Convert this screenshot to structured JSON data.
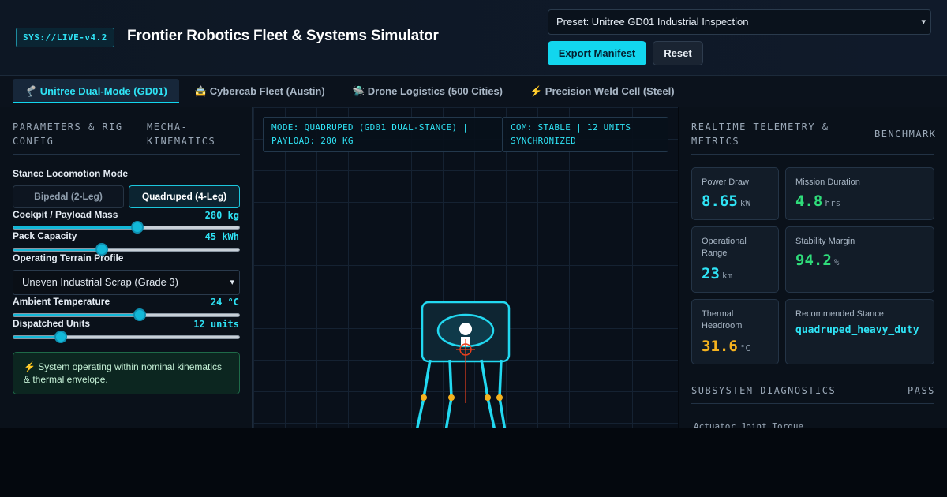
{
  "header": {
    "badge": "SYS://LIVE-v4.2",
    "title": "Frontier Robotics Fleet & Systems Simulator",
    "preset_value": "Preset: Unitree GD01 Industrial Inspection",
    "export_label": "Export Manifest",
    "reset_label": "Reset"
  },
  "tabs": [
    {
      "label": "🦿 Unitree Dual-Mode (GD01)",
      "active": true
    },
    {
      "label": "🚖 Cybercab Fleet (Austin)",
      "active": false
    },
    {
      "label": "🛸 Drone Logistics (500 Cities)",
      "active": false
    },
    {
      "label": "⚡ Precision Weld Cell (Steel)",
      "active": false
    }
  ],
  "left": {
    "head_left": "PARAMETERS & RIG CONFIG",
    "head_right": "MECHA-KINEMATICS",
    "stance_label": "Stance Locomotion Mode",
    "stance_options": [
      "Bipedal (2-Leg)",
      "Quadruped (4-Leg)"
    ],
    "payload_label": "Cockpit / Payload Mass",
    "payload_value": "280 kg",
    "payload_level": 0.55,
    "pack_label": "Pack Capacity",
    "pack_value": "45 kWh",
    "pack_level": 0.39,
    "terrain_label": "Operating Terrain Profile",
    "terrain_value": "Uneven Industrial Scrap (Grade 3)",
    "temp_label": "Ambient Temperature",
    "temp_value": "24 °C",
    "temp_level": 0.56,
    "units_label": "Dispatched Units",
    "units_value": "12 units",
    "units_level": 0.21,
    "status_text": "⚡ System operating within nominal kinematics & thermal envelope."
  },
  "center": {
    "hud_mode": "MODE: QUADRUPED (GD01 DUAL-STANCE) | PAYLOAD: 280 KG",
    "hud_com": "COM: STABLE | 12 UNITS SYNCHRONIZED"
  },
  "right": {
    "head_left": "REALTIME TELEMETRY & METRICS",
    "head_right": "BENCHMARK",
    "metrics": [
      {
        "label": "Power Draw",
        "value": "8.65",
        "unit": "kW"
      },
      {
        "label": "Mission Duration",
        "value": "4.8",
        "unit": "hrs"
      },
      {
        "label": "Operational Range",
        "value": "23",
        "unit": "km"
      },
      {
        "label": "Stability Margin",
        "value": "94.2",
        "unit": "%"
      },
      {
        "label": "Thermal Headroom",
        "value": "31.6",
        "unit": "°C"
      },
      {
        "label": "Recommended Stance",
        "value": "quadruped_heavy_duty",
        "unit": ""
      }
    ],
    "diag_head_left": "SUBSYSTEM DIAGNOSTICS",
    "diag_head_right": "PASS",
    "diag_item": "Actuator Joint Torque"
  },
  "colors": {
    "accent": "#12d6ee",
    "green": "#2fdc7a",
    "amber": "#f5b21e"
  }
}
